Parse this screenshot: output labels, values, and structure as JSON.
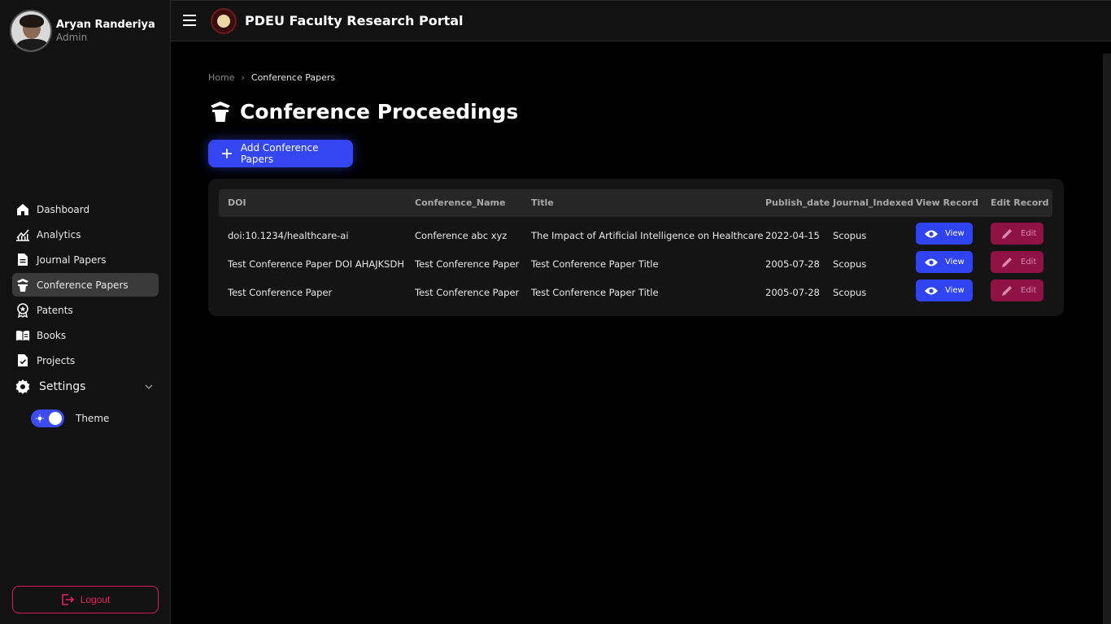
{
  "user": {
    "name": "Aryan Randeriya",
    "role": "Admin"
  },
  "app": {
    "title": "PDEU Faculty Research Portal"
  },
  "sidebar": {
    "items": [
      {
        "label": "Dashboard",
        "icon": "home-icon"
      },
      {
        "label": "Analytics",
        "icon": "chart-line-icon"
      },
      {
        "label": "Journal Papers",
        "icon": "document-icon"
      },
      {
        "label": "Conference Papers",
        "icon": "podium-icon",
        "active": true
      },
      {
        "label": "Patents",
        "icon": "award-icon"
      },
      {
        "label": "Books",
        "icon": "book-icon"
      },
      {
        "label": "Projects",
        "icon": "file-check-icon"
      }
    ],
    "settings_label": "Settings",
    "theme_label": "Theme",
    "logout_label": "Logout"
  },
  "breadcrumb": {
    "home": "Home",
    "current": "Conference Papers"
  },
  "page": {
    "title": "Conference Proceedings",
    "add_button": "Add Conference Papers"
  },
  "table": {
    "headers": [
      "DOI",
      "Conference_Name",
      "Title",
      "Publish_date",
      "Journal_Indexed",
      "View Record",
      "Edit Record"
    ],
    "view_label": "View",
    "edit_label": "Edit",
    "rows": [
      {
        "doi": "doi:10.1234/healthcare-ai",
        "conference": "Conference abc xyz",
        "title": "The Impact of Artificial Intelligence on Healthcare",
        "date": "2022-04-15",
        "indexed": "Scopus"
      },
      {
        "doi": "Test Conference Paper DOI AHAJKSDH",
        "conference": "Test Conference Paper",
        "title": "Test Conference Paper Title",
        "date": "2005-07-28",
        "indexed": "Scopus"
      },
      {
        "doi": "Test Conference Paper",
        "conference": "Test Conference Paper",
        "title": "Test Conference Paper Title",
        "date": "2005-07-28",
        "indexed": "Scopus"
      }
    ]
  },
  "colors": {
    "accent": "#3346f0",
    "edit": "#8e1244",
    "logout": "#e91e63",
    "background": "#000000",
    "sidebar": "#121212"
  }
}
